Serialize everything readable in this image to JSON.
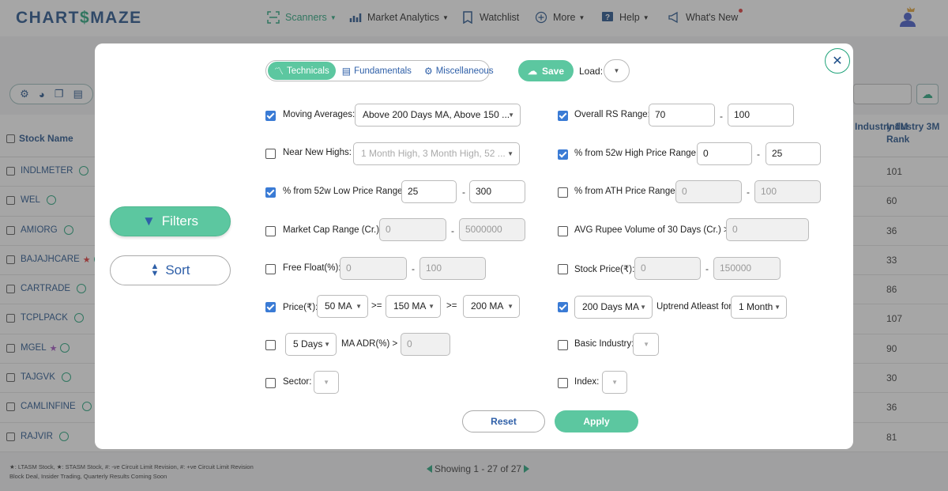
{
  "app": {
    "logo_left": "CHART",
    "logo_mid": "$",
    "logo_right": "MAZE"
  },
  "nav": [
    {
      "label": "Scanners"
    },
    {
      "label": "Market Analytics"
    },
    {
      "label": "Watchlist"
    },
    {
      "label": "More"
    },
    {
      "label": "Help"
    },
    {
      "label": "What's New"
    }
  ],
  "table": {
    "col_stock": "Stock Name",
    "col_ind1m": "Industry 1M",
    "col_ind3m_l1": "Industry 3M",
    "col_ind3m_l2": "Rank",
    "rows": [
      {
        "name": "INDLMETER",
        "badge": "",
        "rank": "101"
      },
      {
        "name": "WEL",
        "badge": "",
        "rank": "60"
      },
      {
        "name": "AMIORG",
        "badge": "",
        "rank": "36"
      },
      {
        "name": "BAJAJHCARE",
        "badge": "★",
        "rank": "33"
      },
      {
        "name": "CARTRADE",
        "badge": "",
        "rank": "86"
      },
      {
        "name": "TCPLPACK",
        "badge": "",
        "rank": "107"
      },
      {
        "name": "MGEL",
        "badge": "★",
        "rank": "90"
      },
      {
        "name": "TAJGVK",
        "badge": "",
        "rank": "30"
      },
      {
        "name": "CAMLINFINE",
        "badge": "",
        "rank": "36"
      },
      {
        "name": "RAJVIR",
        "badge": "",
        "rank": "81"
      }
    ]
  },
  "legend": {
    "line1": "★: LTASM Stock, ★: STASM Stock, #: -ve Circuit Limit Revision, #: +ve Circuit Limit Revision",
    "line2": "Block Deal, Insider Trading, Quarterly Results Coming Soon"
  },
  "pager": {
    "text": "Showing 1 - 27 of 27"
  },
  "modal": {
    "tabs": [
      {
        "label": "Technicals",
        "active": true
      },
      {
        "label": "Fundamentals",
        "active": false
      },
      {
        "label": "Miscellaneous",
        "active": false
      }
    ],
    "save_label": "Save",
    "load_label": "Load:",
    "side": {
      "filters": "Filters",
      "sort": "Sort"
    },
    "left": {
      "moving_averages": {
        "label": "Moving Averages:",
        "checked": true,
        "value": "Above 200 Days MA, Above 150 ..."
      },
      "near_new_highs": {
        "label": "Near New Highs:",
        "checked": false,
        "value": "1 Month High, 3 Month High, 52 ..."
      },
      "from_52w_low": {
        "label": "% from 52w Low Price Range:",
        "checked": true,
        "min": "25",
        "max": "300"
      },
      "market_cap": {
        "label": "Market Cap Range (Cr.):",
        "checked": false,
        "min": "0",
        "max": "5000000"
      },
      "free_float": {
        "label": "Free Float(%):",
        "checked": false,
        "min": "0",
        "max": "100"
      },
      "price": {
        "label": "Price(₹):",
        "checked": true,
        "ma1": "50 MA",
        "op1": ">=",
        "ma2": "150 MA",
        "op2": ">=",
        "ma3": "200 MA"
      },
      "ma_adr": {
        "checked": false,
        "period": "5 Days",
        "label": "MA ADR(%) >",
        "value": "0"
      },
      "sector": {
        "label": "Sector:",
        "checked": false
      }
    },
    "right": {
      "overall_rs": {
        "label": "Overall RS Range:",
        "checked": true,
        "min": "70",
        "max": "100"
      },
      "from_52w_high": {
        "label": "% from 52w High Price Range:",
        "checked": true,
        "min": "0",
        "max": "25"
      },
      "from_ath": {
        "label": "% from ATH Price Range:",
        "checked": false,
        "min": "0",
        "max": "100"
      },
      "avg_rupee_vol": {
        "label": "AVG Rupee Volume of 30 Days (Cr.) >",
        "checked": false,
        "value": "0"
      },
      "stock_price": {
        "label": "Stock Price(₹):",
        "checked": false,
        "min": "0",
        "max": "150000"
      },
      "uptrend": {
        "checked": true,
        "ma": "200 Days MA",
        "label": "Uptrend Atleast for",
        "period": "1 Month"
      },
      "basic_industry": {
        "label": "Basic Industry:",
        "checked": false
      },
      "index": {
        "label": "Index:",
        "checked": false
      }
    },
    "dash": "-",
    "reset_label": "Reset",
    "apply_label": "Apply"
  },
  "colors": {
    "accent": "#5cc7a0",
    "brand": "#1d4e89",
    "checkbox": "#3a7bd5"
  }
}
